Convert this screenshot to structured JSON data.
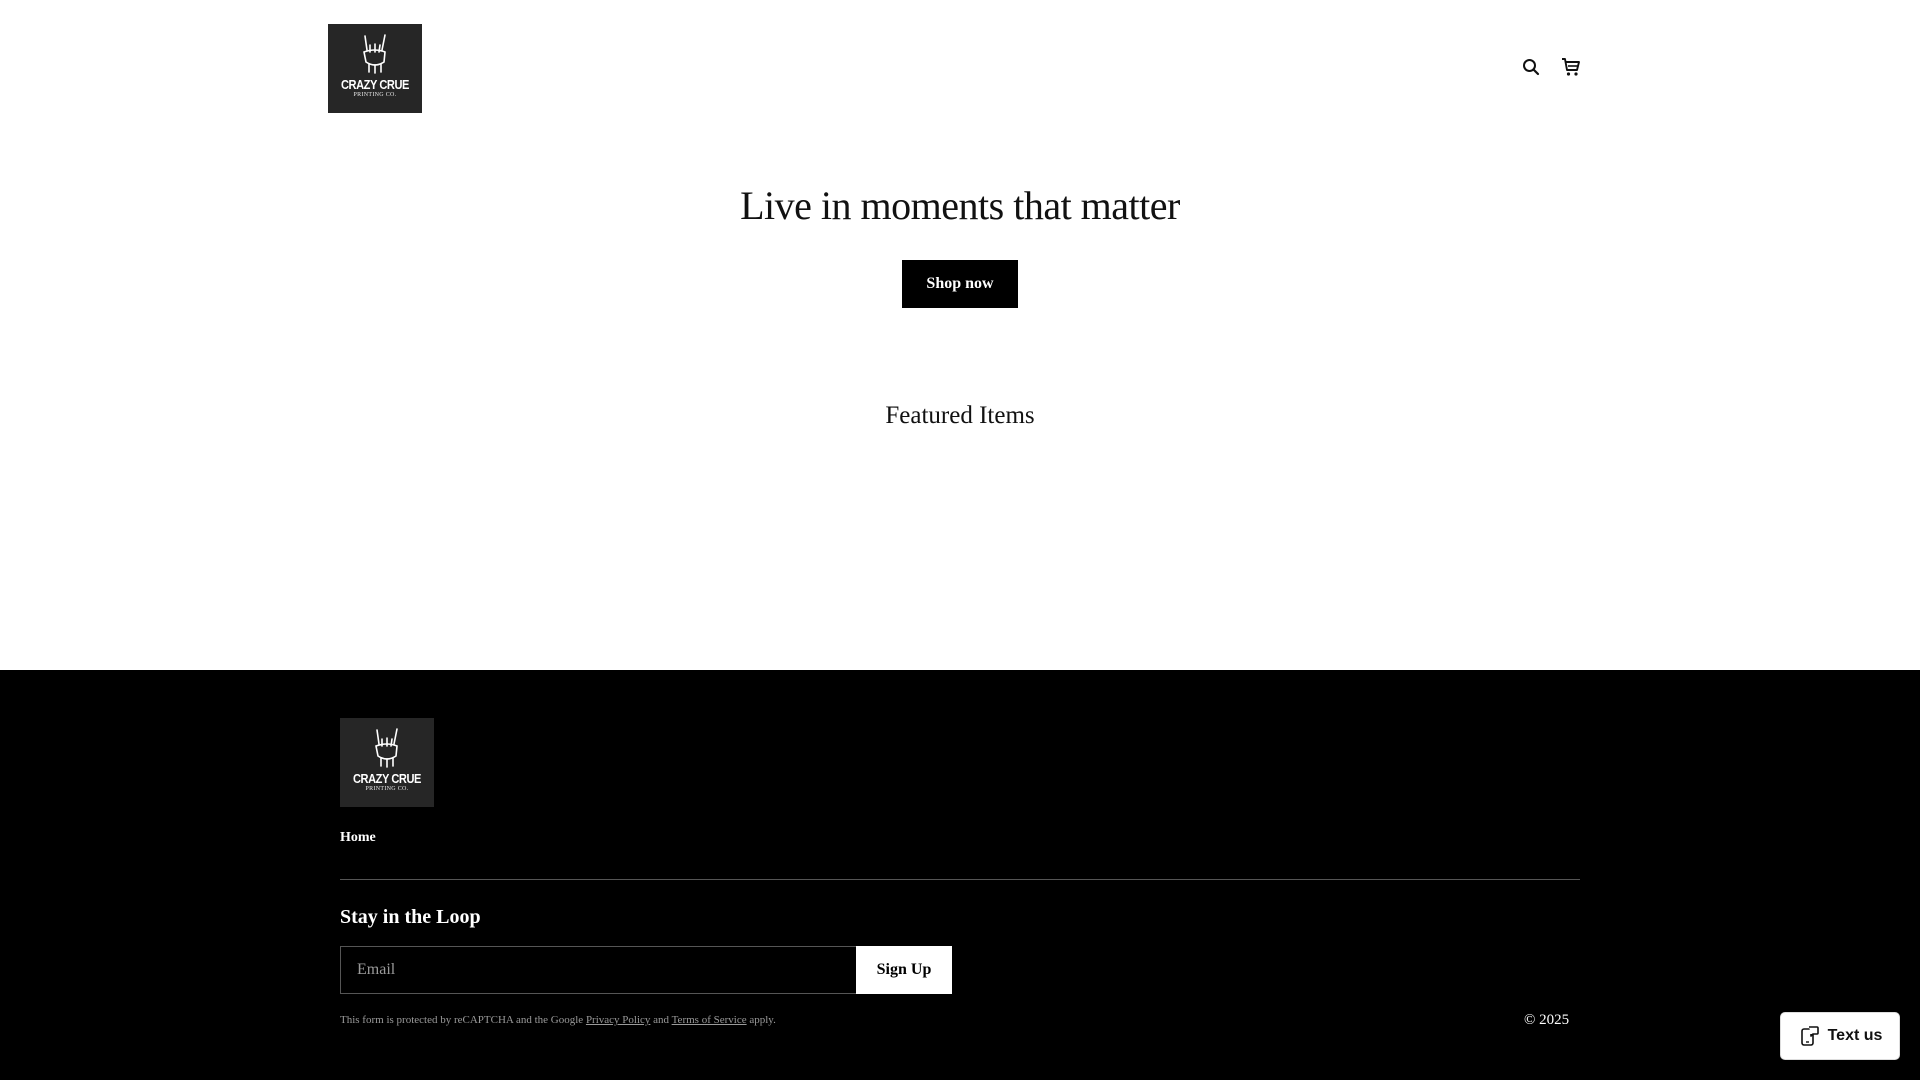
{
  "header": {
    "logo": {
      "brand": "CRAZY CRUE",
      "sub": "PRINTING CO."
    },
    "icons": [
      "search-icon",
      "cart-icon"
    ]
  },
  "hero": {
    "title": "Live in moments that matter",
    "button_label": "Shop now"
  },
  "featured": {
    "title": "Featured Items"
  },
  "footer": {
    "logo": {
      "brand": "CRAZY CRUE",
      "sub": "PRINTING CO."
    },
    "nav": {
      "home_label": "Home"
    },
    "newsletter": {
      "title": "Stay in the Loop",
      "email_placeholder": "Email",
      "email_value": "",
      "signup_label": "Sign Up"
    },
    "recaptcha": {
      "prefix": "This form is protected by reCAPTCHA and the Google",
      "privacy_label": "Privacy Policy",
      "and": "and",
      "terms_label": "Terms of Service",
      "suffix": "apply."
    },
    "copyright": "© 2025"
  },
  "widget": {
    "text_us_label": "Text us"
  },
  "colors": {
    "background": "#ffffff",
    "footer_bg": "#000000",
    "logo_bg": "#262626",
    "primary_button": "#000000"
  }
}
